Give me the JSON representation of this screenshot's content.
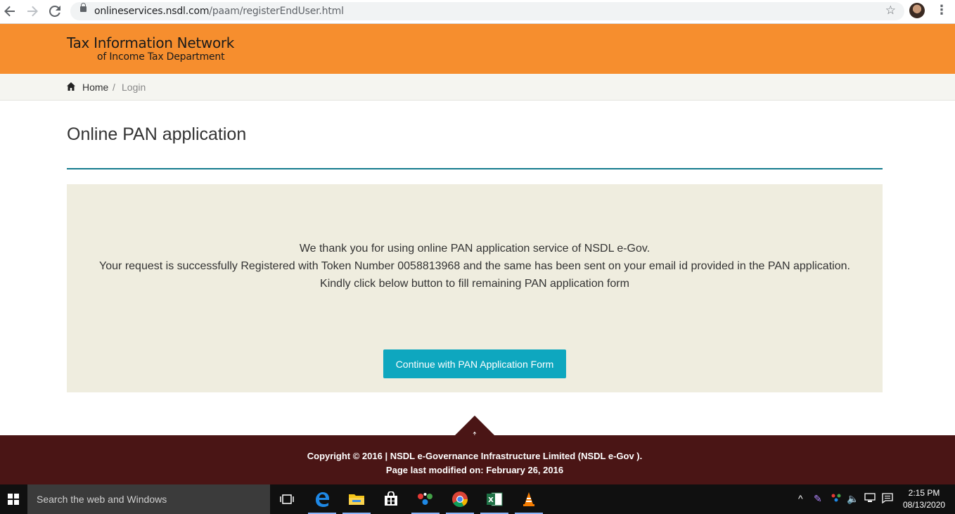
{
  "browser": {
    "url_host": "onlineservices.nsdl.com",
    "url_path": "/paam/registerEndUser.html"
  },
  "header": {
    "title_line1": "Tax Information Network",
    "title_line2": "of Income Tax Department",
    "bg_color": "#f68e2e"
  },
  "breadcrumb": {
    "home": "Home",
    "separator": "/",
    "current": "Login"
  },
  "main": {
    "title": "Online PAN application",
    "message_line1": "We thank you for using online PAN application service of NSDL e-Gov.",
    "message_line2": "Your request is successfully Registered with Token Number 0058813968 and the same has been sent on your email id provided in the PAN application.",
    "message_line3": "Kindly click below button to fill remaining PAN application form",
    "button_label": "Continue with PAN Application Form",
    "accent_color": "#0ea7bf"
  },
  "footer": {
    "copyright": "Copyright © 2016 | NSDL e-Governance Infrastructure Limited (NSDL e-Gov ).",
    "last_modified": "Page last modified on: February 26, 2016",
    "bg_color": "#4a1515"
  },
  "taskbar": {
    "search_placeholder": "Search the web and Windows",
    "time": "2:15 PM",
    "date": "08/13/2020",
    "icons": [
      "task-view-icon",
      "edge-icon",
      "file-explorer-icon",
      "store-icon",
      "app-icon",
      "chrome-icon",
      "excel-icon",
      "vlc-icon"
    ]
  }
}
